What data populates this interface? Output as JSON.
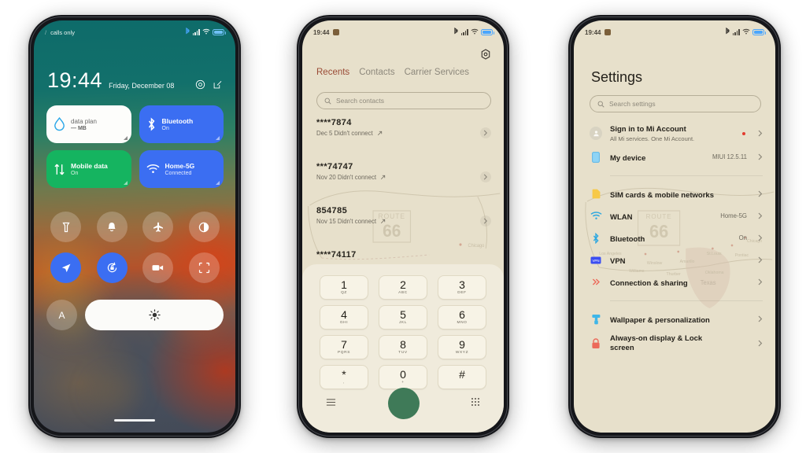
{
  "phone1": {
    "name": "control-center",
    "statusbar": {
      "carrier": "calls only",
      "time_hidden": "",
      "icons": [
        "bluetooth-icon",
        "signal-icon",
        "wifi-icon",
        "battery-icon"
      ]
    },
    "clock": {
      "time": "19:44",
      "date": "Friday, December 08"
    },
    "header_actions": [
      {
        "name": "settings-gear-icon",
        "label": "Settings"
      },
      {
        "name": "edit-icon",
        "label": "Edit"
      }
    ],
    "tiles": [
      {
        "name": "data-plan-tile",
        "title": "data plan",
        "sub": "— MB",
        "icon": "water-drop-icon",
        "style": "white"
      },
      {
        "name": "bluetooth-tile",
        "title": "Bluetooth",
        "sub": "On",
        "icon": "bluetooth-icon",
        "style": "blue"
      },
      {
        "name": "mobile-data-tile",
        "title": "Mobile data",
        "sub": "On",
        "icon": "data-arrows-icon",
        "style": "green"
      },
      {
        "name": "wifi-tile",
        "title": "Home-5G",
        "sub": "Connected",
        "icon": "wifi-icon",
        "style": "blue"
      }
    ],
    "toggles": [
      {
        "name": "flashlight-toggle",
        "icon": "flashlight-icon",
        "on": false
      },
      {
        "name": "silent-toggle",
        "icon": "bell-icon",
        "on": false
      },
      {
        "name": "airplane-mode-toggle",
        "icon": "airplane-icon",
        "on": false
      },
      {
        "name": "dark-mode-toggle",
        "icon": "contrast-icon",
        "on": false
      },
      {
        "name": "location-toggle",
        "icon": "location-arrow-icon",
        "on": true
      },
      {
        "name": "auto-rotate-toggle",
        "icon": "rotate-lock-icon",
        "on": true
      },
      {
        "name": "screen-recorder-toggle",
        "icon": "video-camera-icon",
        "on": false
      },
      {
        "name": "screenshot-toggle",
        "icon": "crop-frame-icon",
        "on": false
      }
    ],
    "brightness": {
      "auto_label": "A",
      "icon": "brightness-sun-icon"
    }
  },
  "phone2": {
    "name": "phone-dialer",
    "statusbar": {
      "time": "19:44",
      "badge": "alarm-icon"
    },
    "gear": "settings-gear-icon",
    "tabs": [
      {
        "label": "Recents",
        "active": true
      },
      {
        "label": "Contacts",
        "active": false
      },
      {
        "label": "Carrier Services",
        "active": false
      }
    ],
    "search": {
      "placeholder": "Search contacts",
      "icon": "search-icon"
    },
    "calls": [
      {
        "number": "****7874",
        "meta": "Dec 5 Didn't connect"
      },
      {
        "number": "***74747",
        "meta": "Nov 20 Didn't connect"
      },
      {
        "number": "854785",
        "meta": "Nov 15 Didn't connect"
      },
      {
        "number": "****74117",
        "meta": ""
      }
    ],
    "keypad": [
      {
        "digit": "1",
        "letters": "QZ"
      },
      {
        "digit": "2",
        "letters": "ABC"
      },
      {
        "digit": "3",
        "letters": "DEF"
      },
      {
        "digit": "4",
        "letters": "GHI"
      },
      {
        "digit": "5",
        "letters": "JKL"
      },
      {
        "digit": "6",
        "letters": "MNO"
      },
      {
        "digit": "7",
        "letters": "PQRS"
      },
      {
        "digit": "8",
        "letters": "TUV"
      },
      {
        "digit": "9",
        "letters": "WXYZ"
      },
      {
        "digit": "*",
        "letters": ","
      },
      {
        "digit": "0",
        "letters": "+"
      },
      {
        "digit": "#",
        "letters": ""
      }
    ],
    "bottom": {
      "menu_icon": "hamburger-menu-icon",
      "call_button": "call-button",
      "keypad_icon": "dialpad-icon"
    },
    "watermark": "route-66-map"
  },
  "phone3": {
    "name": "settings",
    "statusbar": {
      "time": "19:44",
      "badge": "alarm-icon"
    },
    "title": "Settings",
    "search": {
      "placeholder": "Search settings",
      "icon": "search-icon"
    },
    "items": [
      {
        "label": "Sign in to Mi Account",
        "sub": "All Mi services. One Mi Account.",
        "value": "",
        "icon": "account-avatar-icon",
        "dot": true
      },
      {
        "label": "My device",
        "sub": "",
        "value": "MIUI 12.5.11",
        "icon": "device-icon",
        "dot": false
      },
      {
        "divider": true
      },
      {
        "label": "SIM cards & mobile networks",
        "sub": "",
        "value": "",
        "icon": "sim-card-icon",
        "dot": false
      },
      {
        "label": "WLAN",
        "sub": "",
        "value": "Home-5G",
        "icon": "wifi-icon",
        "dot": false
      },
      {
        "label": "Bluetooth",
        "sub": "",
        "value": "On",
        "icon": "bluetooth-icon",
        "dot": false
      },
      {
        "label": "VPN",
        "sub": "",
        "value": "",
        "icon": "vpn-icon",
        "dot": false
      },
      {
        "label": "Connection & sharing",
        "sub": "",
        "value": "",
        "icon": "connection-sharing-icon",
        "dot": false
      },
      {
        "divider": true
      },
      {
        "label": "Wallpaper & personalization",
        "sub": "",
        "value": "",
        "icon": "wallpaper-brush-icon",
        "dot": false
      },
      {
        "label": "Always-on display & Lock screen",
        "sub": "",
        "value": "",
        "icon": "lock-icon",
        "dot": false
      }
    ],
    "watermark": "route-66-map"
  },
  "colors": {
    "beige_bg": "#e7e0cb",
    "accent_blue": "#3b6ef2",
    "accent_green": "#15b460",
    "call_green": "#3f7a58",
    "tab_active": "#9a4b36",
    "red_dot": "#e23b2e"
  }
}
